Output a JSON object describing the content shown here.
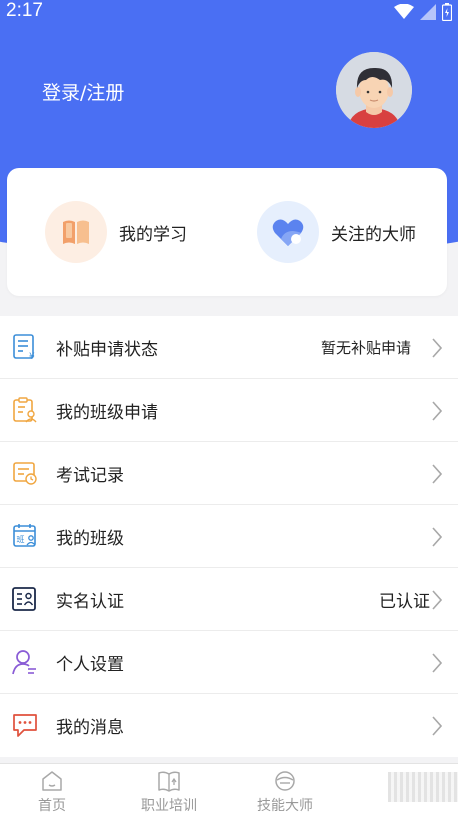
{
  "status_bar": {
    "time": "2:17"
  },
  "header": {
    "login_label": "登录/注册",
    "bg_color": "#4a6ff3"
  },
  "quick": {
    "study_label": "我的学习",
    "master_label": "关注的大师"
  },
  "menu": [
    {
      "label": "补贴申请状态",
      "value": "暂无补贴申请",
      "icon": "subsidy-doc-icon"
    },
    {
      "label": "我的班级申请",
      "value": "",
      "icon": "class-application-icon"
    },
    {
      "label": "考试记录",
      "value": "",
      "icon": "exam-record-icon"
    },
    {
      "label": "我的班级",
      "value": "",
      "icon": "my-class-icon"
    },
    {
      "label": "实名认证",
      "value": "已认证",
      "icon": "id-card-icon"
    },
    {
      "label": "个人设置",
      "value": "",
      "icon": "person-settings-icon"
    },
    {
      "label": "我的消息",
      "value": "",
      "icon": "message-icon"
    }
  ],
  "bottom_nav": [
    {
      "label": "首页",
      "icon": "home-icon"
    },
    {
      "label": "职业培训",
      "icon": "book-icon"
    },
    {
      "label": "技能大师",
      "icon": "master-icon"
    },
    {
      "label": "",
      "icon": "unknown"
    }
  ]
}
